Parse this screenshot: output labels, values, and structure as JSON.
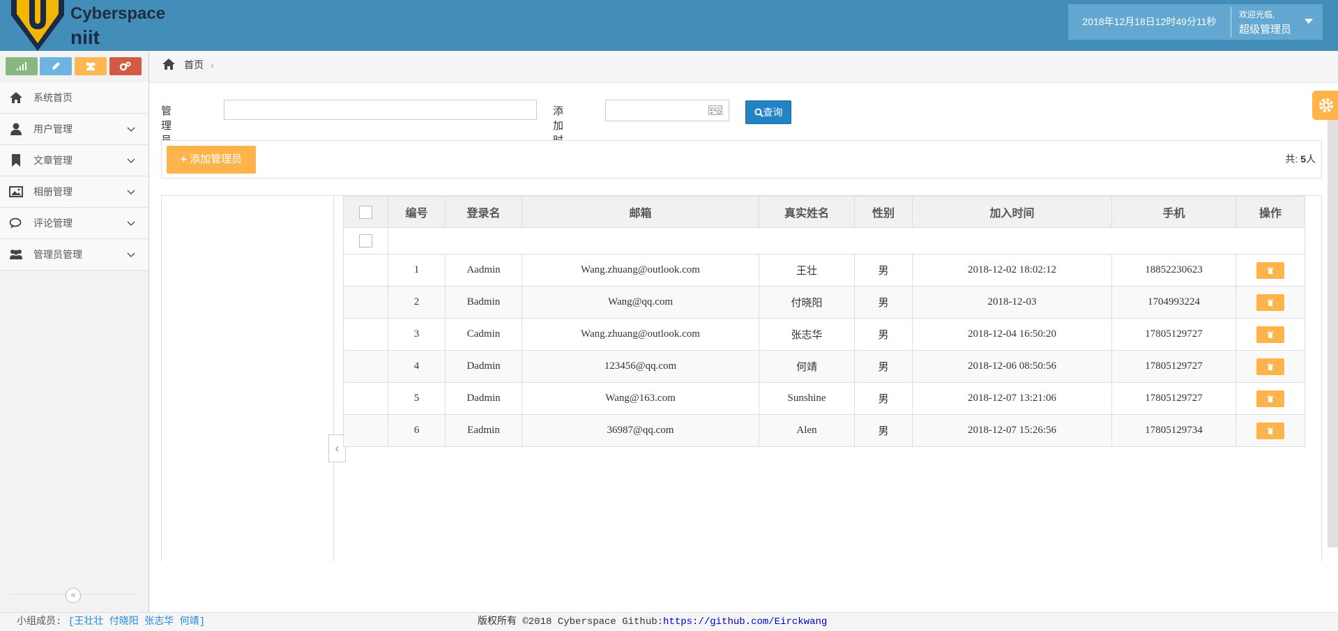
{
  "header": {
    "logo_line1": "Cyberspace",
    "logo_line2": "niit",
    "datetime": "2018年12月18日12时49分11秒",
    "welcome": "欢迎光临,",
    "role": "超级管理员"
  },
  "colors": {
    "header_bg": "#438eb9",
    "user_box_bg": "#62a8d1",
    "shortcut_green": "#87b87f",
    "shortcut_blue": "#6fb3e0",
    "shortcut_orange": "#ffb752",
    "shortcut_red": "#d15b47",
    "primary_button": "#2283c5",
    "warning_button": "#ffb44b"
  },
  "sidebar": {
    "shortcuts": [
      {
        "icon": "signal-icon"
      },
      {
        "icon": "pencil-icon"
      },
      {
        "icon": "users-icon"
      },
      {
        "icon": "cogs-icon"
      }
    ],
    "items": [
      {
        "label": "系统首页",
        "icon": "home-icon"
      },
      {
        "label": "用户管理",
        "icon": "user-icon"
      },
      {
        "label": "文章管理",
        "icon": "bookmark-icon"
      },
      {
        "label": "相册管理",
        "icon": "picture-icon"
      },
      {
        "label": "评论管理",
        "icon": "comments-icon"
      },
      {
        "label": "管理员管理",
        "icon": "group-icon"
      }
    ]
  },
  "breadcrumb": {
    "home": "首页",
    "separator": "›"
  },
  "search": {
    "name_label": "管理员名称",
    "name_value": "",
    "time_label": "添加时间",
    "time_value": "",
    "button_label": "查询"
  },
  "toolbar": {
    "add_label": "添加管理员",
    "total_prefix": "共: ",
    "total_count": "5",
    "total_suffix": "人"
  },
  "table": {
    "columns": [
      "编号",
      "登录名",
      "邮箱",
      "真实姓名",
      "性别",
      "加入时间",
      "手机",
      "操作"
    ],
    "rows": [
      {
        "id": "1",
        "login": "Aadmin",
        "email": "Wang.zhuang@outlook.com",
        "name": "王壮",
        "gender": "男",
        "joined": "2018-12-02 18:02:12",
        "phone": "18852230623"
      },
      {
        "id": "2",
        "login": "Badmin",
        "email": "Wang@qq.com",
        "name": "付晓阳",
        "gender": "男",
        "joined": "2018-12-03",
        "phone": "1704993224"
      },
      {
        "id": "3",
        "login": "Cadmin",
        "email": "Wang.zhuang@outlook.com",
        "name": "张志华",
        "gender": "男",
        "joined": "2018-12-04 16:50:20",
        "phone": "17805129727"
      },
      {
        "id": "4",
        "login": "Dadmin",
        "email": "123456@qq.com",
        "name": "何靖",
        "gender": "男",
        "joined": "2018-12-06 08:50:56",
        "phone": "17805129727"
      },
      {
        "id": "5",
        "login": "Dadmin",
        "email": "Wang@163.com",
        "name": "Sunshine",
        "gender": "男",
        "joined": "2018-12-07 13:21:06",
        "phone": "17805129727"
      },
      {
        "id": "6",
        "login": "Eadmin",
        "email": "36987@qq.com",
        "name": "Alen",
        "gender": "男",
        "joined": "2018-12-07 15:26:56",
        "phone": "17805129734"
      }
    ]
  },
  "footer": {
    "members_label": "小组成员:",
    "members": "[王壮壮 付晓阳 张志华 何靖]",
    "copyright": "版权所有 ©2018 Cyberspace Github:",
    "github_link": "https://github.com/Eirckwang"
  }
}
